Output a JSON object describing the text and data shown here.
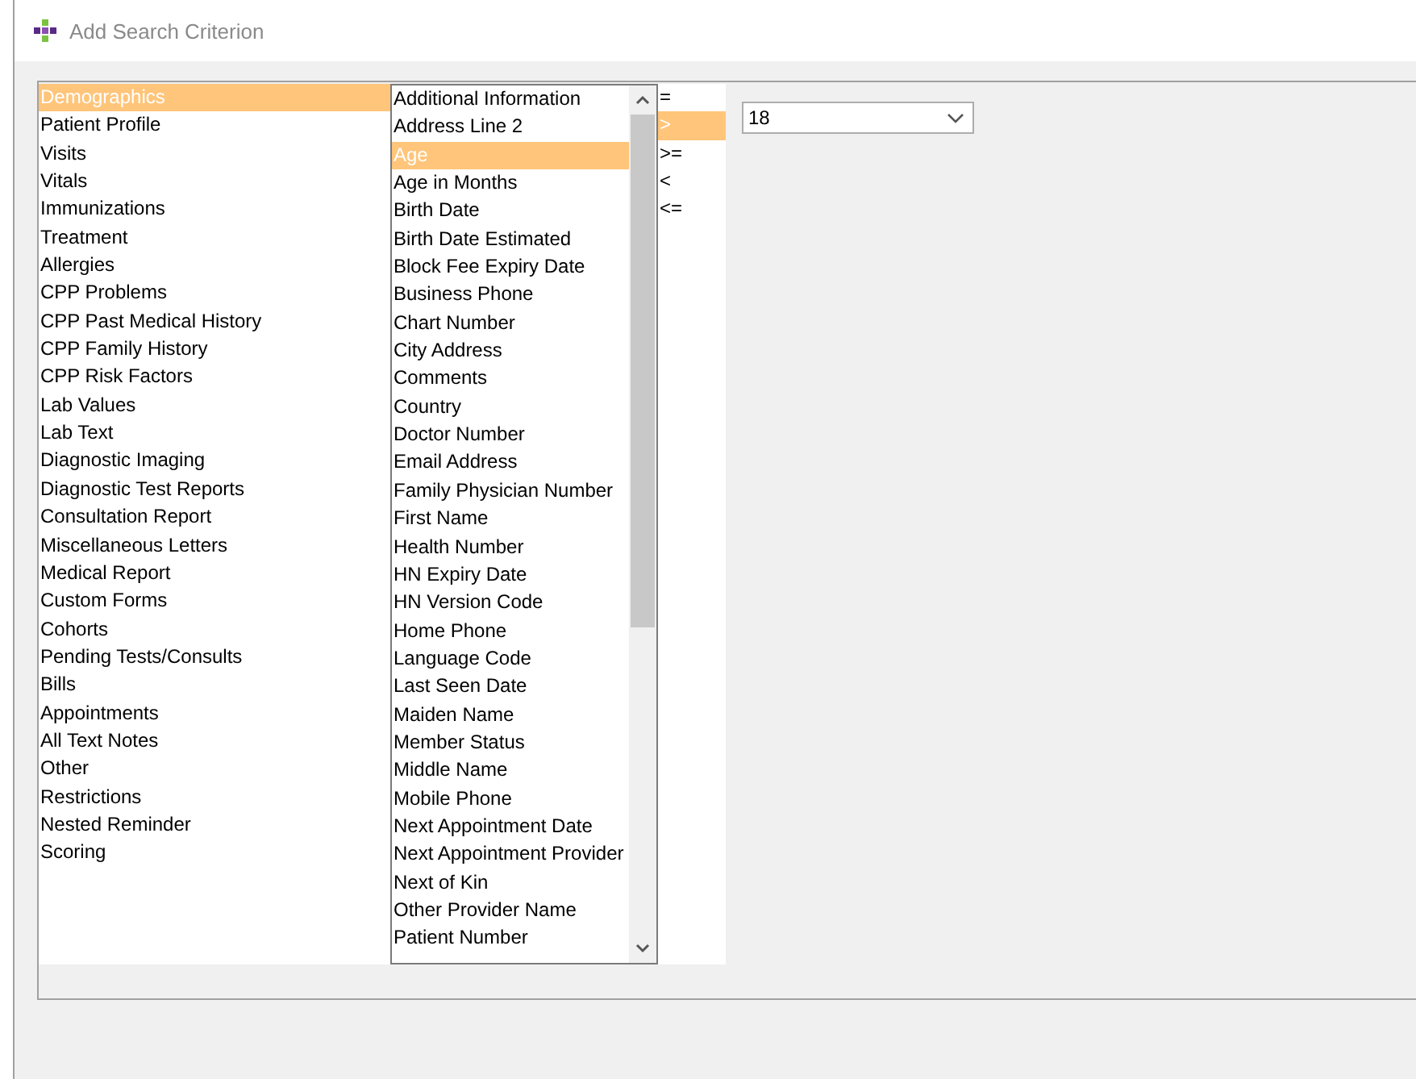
{
  "window": {
    "title": "Add Search Criterion"
  },
  "categories": [
    {
      "label": "Demographics",
      "selected": true
    },
    {
      "label": "Patient Profile",
      "selected": false
    },
    {
      "label": "Visits",
      "selected": false
    },
    {
      "label": "Vitals",
      "selected": false
    },
    {
      "label": "Immunizations",
      "selected": false
    },
    {
      "label": "Treatment",
      "selected": false
    },
    {
      "label": "Allergies",
      "selected": false
    },
    {
      "label": "CPP Problems",
      "selected": false
    },
    {
      "label": "CPP Past Medical History",
      "selected": false
    },
    {
      "label": "CPP Family History",
      "selected": false
    },
    {
      "label": "CPP Risk Factors",
      "selected": false
    },
    {
      "label": "Lab Values",
      "selected": false
    },
    {
      "label": "Lab Text",
      "selected": false
    },
    {
      "label": "Diagnostic Imaging",
      "selected": false
    },
    {
      "label": "Diagnostic Test Reports",
      "selected": false
    },
    {
      "label": "Consultation Report",
      "selected": false
    },
    {
      "label": "Miscellaneous Letters",
      "selected": false
    },
    {
      "label": "Medical Report",
      "selected": false
    },
    {
      "label": "Custom Forms",
      "selected": false
    },
    {
      "label": "Cohorts",
      "selected": false
    },
    {
      "label": "Pending Tests/Consults",
      "selected": false
    },
    {
      "label": "Bills",
      "selected": false
    },
    {
      "label": "Appointments",
      "selected": false
    },
    {
      "label": "All Text Notes",
      "selected": false
    },
    {
      "label": "Other",
      "selected": false
    },
    {
      "label": "Restrictions",
      "selected": false
    },
    {
      "label": "Nested Reminder",
      "selected": false
    },
    {
      "label": "Scoring",
      "selected": false
    }
  ],
  "fields": [
    {
      "label": "Additional Information",
      "selected": false
    },
    {
      "label": "Address Line 2",
      "selected": false
    },
    {
      "label": "Age",
      "selected": true
    },
    {
      "label": "Age in Months",
      "selected": false
    },
    {
      "label": "Birth Date",
      "selected": false
    },
    {
      "label": "Birth Date Estimated",
      "selected": false
    },
    {
      "label": "Block Fee Expiry Date",
      "selected": false
    },
    {
      "label": "Business Phone",
      "selected": false
    },
    {
      "label": "Chart Number",
      "selected": false
    },
    {
      "label": "City Address",
      "selected": false
    },
    {
      "label": "Comments",
      "selected": false
    },
    {
      "label": "Country",
      "selected": false
    },
    {
      "label": "Doctor Number",
      "selected": false
    },
    {
      "label": "Email Address",
      "selected": false
    },
    {
      "label": "Family Physician Number",
      "selected": false
    },
    {
      "label": "First Name",
      "selected": false
    },
    {
      "label": "Health Number",
      "selected": false
    },
    {
      "label": "HN Expiry Date",
      "selected": false
    },
    {
      "label": "HN Version Code",
      "selected": false
    },
    {
      "label": "Home Phone",
      "selected": false
    },
    {
      "label": "Language Code",
      "selected": false
    },
    {
      "label": "Last Seen Date",
      "selected": false
    },
    {
      "label": "Maiden Name",
      "selected": false
    },
    {
      "label": "Member Status",
      "selected": false
    },
    {
      "label": "Middle Name",
      "selected": false
    },
    {
      "label": "Mobile Phone",
      "selected": false
    },
    {
      "label": "Next Appointment Date",
      "selected": false
    },
    {
      "label": "Next Appointment Provider",
      "selected": false
    },
    {
      "label": "Next of Kin",
      "selected": false
    },
    {
      "label": "Other Provider Name",
      "selected": false
    },
    {
      "label": "Patient Number",
      "selected": false
    }
  ],
  "operators": [
    {
      "label": "=",
      "selected": false
    },
    {
      "label": ">",
      "selected": true
    },
    {
      "label": ">=",
      "selected": false
    },
    {
      "label": "<",
      "selected": false
    },
    {
      "label": "<=",
      "selected": false
    }
  ],
  "value_dropdown": {
    "value": "18"
  }
}
